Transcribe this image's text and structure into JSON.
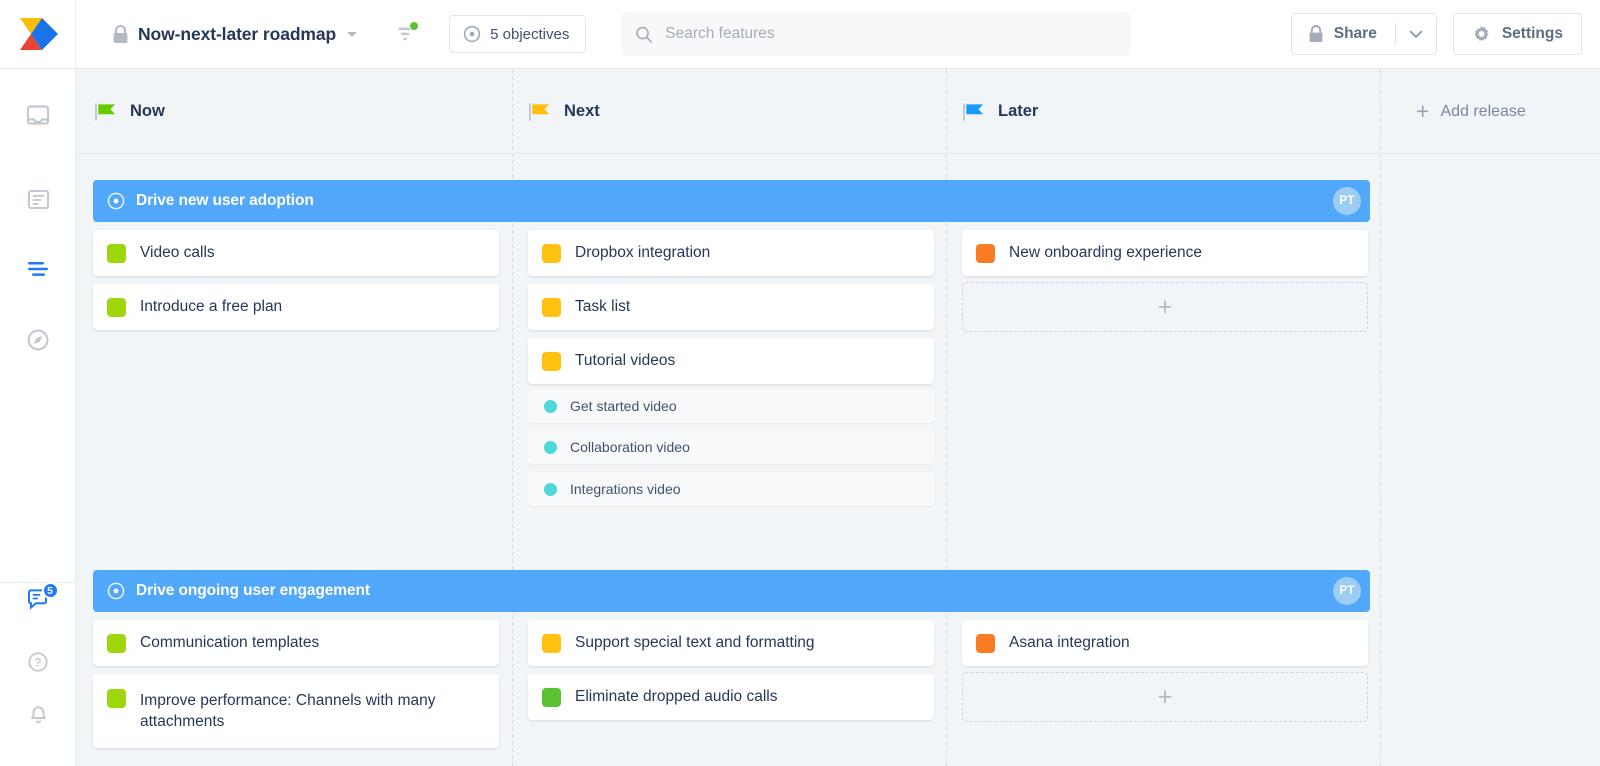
{
  "topbar": {
    "logo_name": "aha-logo",
    "lock_icon": "lock-icon",
    "board_title": "Now-next-later roadmap",
    "title_caret": "chevron-down-icon",
    "filter_icon": "filter-icon",
    "objectives_icon": "target-icon",
    "objectives_label": "5 objectives",
    "search_icon": "search-icon",
    "search_placeholder": "Search features",
    "search_value": "",
    "share_icon": "lock-icon",
    "share_label": "Share",
    "share_caret": "chevron-down-icon",
    "settings_icon": "gear-icon",
    "settings_label": "Settings"
  },
  "leftnav": {
    "items": [
      {
        "name": "sidebar-item-workspace",
        "icon": "window-icon",
        "active": false
      },
      {
        "name": "sidebar-item-documents",
        "icon": "document-icon",
        "active": false
      },
      {
        "name": "sidebar-item-roadmaps",
        "icon": "roadmap-lines-icon",
        "active": true
      },
      {
        "name": "sidebar-item-ideas",
        "icon": "compass-icon",
        "active": false
      }
    ],
    "bottom_items": [
      {
        "name": "sidebar-item-feedback",
        "icon": "message-icon",
        "badge": "5"
      },
      {
        "name": "sidebar-item-help",
        "icon": "help-circle-icon",
        "badge": ""
      },
      {
        "name": "sidebar-item-notifications",
        "icon": "bell-icon",
        "badge": ""
      }
    ]
  },
  "board": {
    "columns": [
      {
        "label": "Now",
        "flag_color": "#66cc00"
      },
      {
        "label": "Next",
        "flag_color": "#ffc107"
      },
      {
        "label": "Later",
        "flag_color": "#1d9bf8"
      }
    ],
    "add_release_label": "Add release",
    "add_release_icon": "plus-icon",
    "add_card_icon": "plus-icon",
    "objectives": [
      {
        "title": "Drive new user adoption",
        "icon": "objective-target-icon",
        "avatar": "PT",
        "cells": [
          {
            "column": "Now",
            "cards": [
              {
                "label": "Video calls",
                "color": "#9ed60c"
              },
              {
                "label": "Introduce a free plan",
                "color": "#9ed60c"
              }
            ],
            "subcards": [],
            "add_placeholder": false
          },
          {
            "column": "Next",
            "cards": [
              {
                "label": "Dropbox integration",
                "color": "#ffc211"
              },
              {
                "label": "Task list",
                "color": "#ffc211"
              },
              {
                "label": "Tutorial videos",
                "color": "#ffc211"
              }
            ],
            "subcards": [
              {
                "label": "Get started video",
                "color": "#4fd8d8"
              },
              {
                "label": "Collaboration video",
                "color": "#4fd8d8"
              },
              {
                "label": "Integrations video",
                "color": "#4fd8d8"
              }
            ],
            "add_placeholder": false
          },
          {
            "column": "Later",
            "cards": [
              {
                "label": "New onboarding experience",
                "color": "#f97c22"
              }
            ],
            "subcards": [],
            "add_placeholder": true
          }
        ]
      },
      {
        "title": "Drive ongoing user engagement",
        "icon": "objective-target-icon",
        "avatar": "PT",
        "cells": [
          {
            "column": "Now",
            "cards": [
              {
                "label": "Communication templates",
                "color": "#9ed60c"
              },
              {
                "label": "Improve performance: Channels with many attachments",
                "color": "#9ed60c"
              }
            ],
            "subcards": [],
            "add_placeholder": false
          },
          {
            "column": "Next",
            "cards": [
              {
                "label": "Support special text and formatting",
                "color": "#ffc211"
              },
              {
                "label": "Eliminate dropped audio calls",
                "color": "#5bc236"
              }
            ],
            "subcards": [],
            "add_placeholder": false
          },
          {
            "column": "Later",
            "cards": [
              {
                "label": "Asana integration",
                "color": "#f97c22"
              }
            ],
            "subcards": [],
            "add_placeholder": true
          }
        ]
      }
    ]
  }
}
